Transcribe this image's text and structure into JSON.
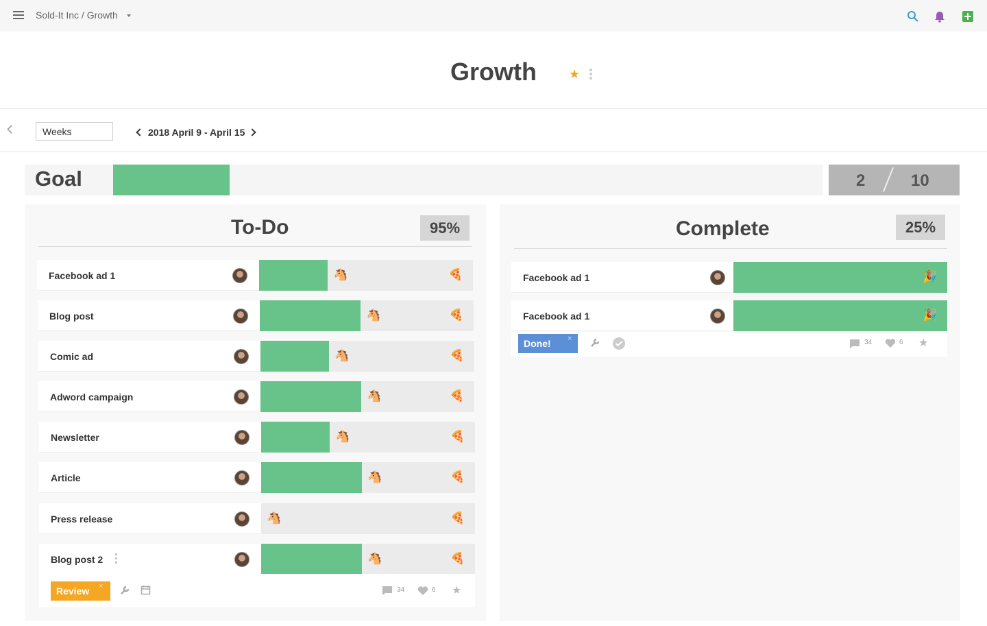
{
  "topbar": {
    "breadcrumb": "Sold-It Inc / Growth",
    "colors": {
      "search": "#3a9ad9",
      "bell": "#9b59b6",
      "add": "#4caf50"
    }
  },
  "header": {
    "title": "Growth"
  },
  "subbar": {
    "period_select": "Weeks",
    "date_range": "2018 April 9 - April 15"
  },
  "goal": {
    "label": "Goal",
    "progress": 0.2,
    "current": "2",
    "target": "10"
  },
  "todo": {
    "title": "To-Do",
    "percent": "95%",
    "items": [
      {
        "name": "Facebook ad 1",
        "progress": 0.32
      },
      {
        "name": "Blog post",
        "progress": 0.47
      },
      {
        "name": "Comic ad",
        "progress": 0.32
      },
      {
        "name": "Adword campaign",
        "progress": 0.47
      },
      {
        "name": "Newsletter",
        "progress": 0.32
      },
      {
        "name": "Article",
        "progress": 0.47
      },
      {
        "name": "Press release",
        "progress": 0.0
      },
      {
        "name": "Blog post 2",
        "progress": 0.47
      }
    ],
    "detail": {
      "status": "Review",
      "status_color": "#f5a623",
      "comments": "34",
      "likes": "6"
    }
  },
  "complete": {
    "title": "Complete",
    "percent": "25%",
    "items": [
      {
        "name": "Facebook ad 1",
        "progress": 1.0
      },
      {
        "name": "Facebook ad 1",
        "progress": 1.0
      }
    ],
    "detail": {
      "status": "Done!",
      "status_color": "#5b8fd6",
      "comments": "34",
      "likes": "6"
    }
  },
  "icons": {
    "horse": "🐴",
    "pizza": "🍕",
    "party": "🎉",
    "close": "×",
    "star": "★"
  }
}
